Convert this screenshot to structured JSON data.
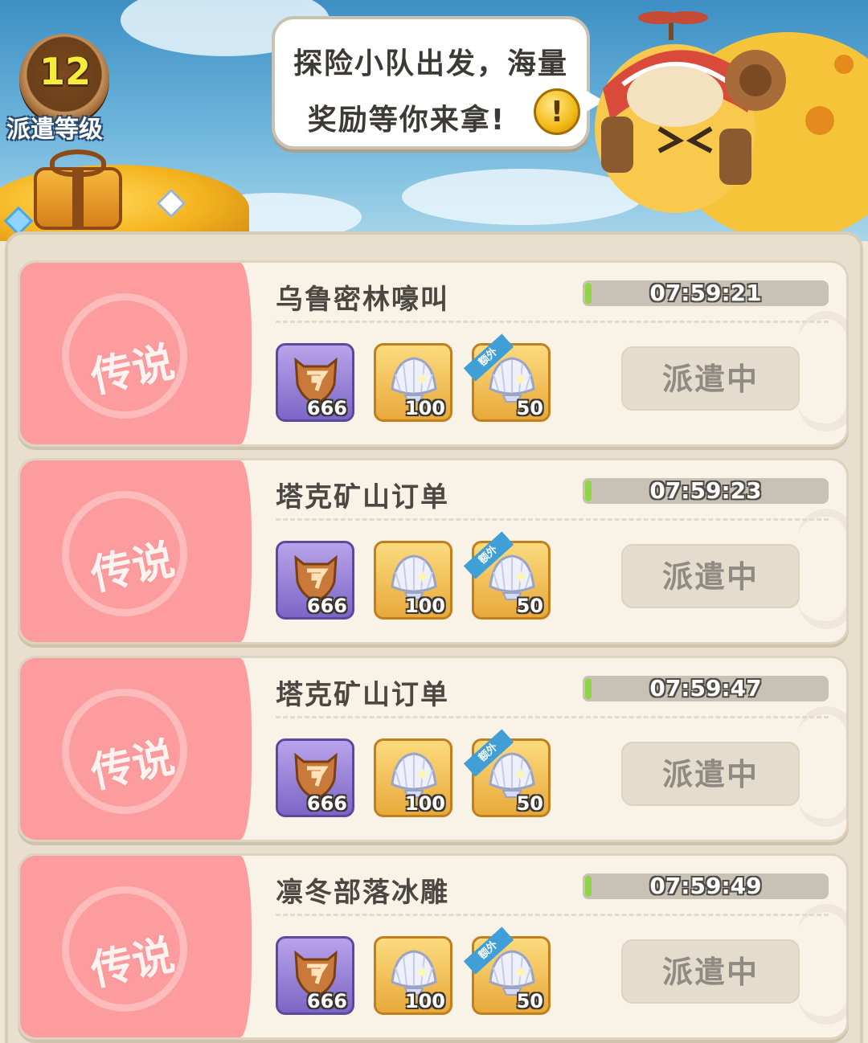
{
  "banner": {
    "level": "12",
    "level_label": "派遣等级",
    "speech_line1": "探险小队出发，海量",
    "speech_line2": "奖励等你来拿!",
    "alert_icon": "!"
  },
  "missions": [
    {
      "rarity": "传说",
      "name": "乌鲁密林嚎叫",
      "timer": "07:59:21",
      "progress": 0.03,
      "rewards": [
        {
          "icon": "bronze-shield-badge",
          "qty": "666",
          "tag": ""
        },
        {
          "icon": "pearl-shell",
          "qty": "100",
          "tag": ""
        },
        {
          "icon": "pearl-shell",
          "qty": "50",
          "tag": "额外"
        }
      ],
      "status": "派遣中"
    },
    {
      "rarity": "传说",
      "name": "塔克矿山订单",
      "timer": "07:59:23",
      "progress": 0.03,
      "rewards": [
        {
          "icon": "bronze-shield-badge",
          "qty": "666",
          "tag": ""
        },
        {
          "icon": "pearl-shell",
          "qty": "100",
          "tag": ""
        },
        {
          "icon": "pearl-shell",
          "qty": "50",
          "tag": "额外"
        }
      ],
      "status": "派遣中"
    },
    {
      "rarity": "传说",
      "name": "塔克矿山订单",
      "timer": "07:59:47",
      "progress": 0.03,
      "rewards": [
        {
          "icon": "bronze-shield-badge",
          "qty": "666",
          "tag": ""
        },
        {
          "icon": "pearl-shell",
          "qty": "100",
          "tag": ""
        },
        {
          "icon": "pearl-shell",
          "qty": "50",
          "tag": "额外"
        }
      ],
      "status": "派遣中"
    },
    {
      "rarity": "传说",
      "name": "凛冬部落冰雕",
      "timer": "07:59:49",
      "progress": 0.03,
      "rewards": [
        {
          "icon": "bronze-shield-badge",
          "qty": "666",
          "tag": ""
        },
        {
          "icon": "pearl-shell",
          "qty": "100",
          "tag": ""
        },
        {
          "icon": "pearl-shell",
          "qty": "50",
          "tag": "额外"
        }
      ],
      "status": "派遣中"
    }
  ],
  "colors": {
    "rarity_bg": "#fc9c9e",
    "card_bg": "#f8f2e7",
    "timer_fill": "#8fd545",
    "level_number": "#f7ec3b"
  }
}
